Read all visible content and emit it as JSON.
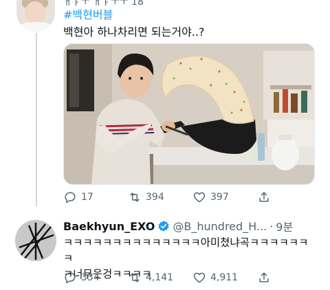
{
  "tweet1": {
    "top_cut_text": "ㅐㅑㅜ ㅐㅑㅜㅜ 18",
    "hashtag": "#백현버블",
    "text": "백현아 하나차리면 되는거야..?",
    "image_alt": "Man in a kitchen flipping fried rice out of a wok in a huge wave",
    "stats": {
      "replies": "17",
      "retweets": "394",
      "likes": "397"
    }
  },
  "tweet2": {
    "display_name": "Baekhyun_EXO",
    "verified": true,
    "handle": "@B_hundred_H...",
    "separator": "·",
    "time": "9분",
    "text_line1": "ㅋㅋㅋㅋㅋㅋㅋㅋㅋㅋㅋㅋㅋㅋ아미쳤냐곡ㅋㅋㅋㅋㅋㅋㅋ",
    "text_line2": "ㅋ너무웃겅ㅋㅋㅋㅋ",
    "stats": {
      "replies": "334",
      "retweets": "4,141",
      "likes": "4,911"
    }
  },
  "colors": {
    "link": "#1d9bf0",
    "muted": "#536471",
    "verified": "#1d9bf0",
    "divider": "#cfd9de"
  },
  "icons": [
    "reply-icon",
    "retweet-icon",
    "like-icon",
    "share-icon",
    "verified-badge-icon",
    "more-icon"
  ]
}
